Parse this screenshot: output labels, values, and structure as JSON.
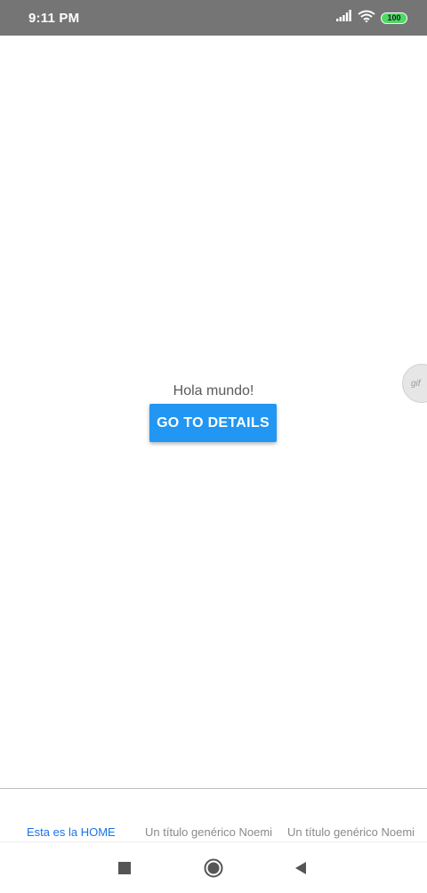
{
  "status_bar": {
    "time": "9:11 PM",
    "battery": "100"
  },
  "main": {
    "greeting": "Hola mundo!",
    "button_label": "GO TO DETAILS",
    "gif_badge": "gif"
  },
  "tabs": [
    {
      "label": "Esta es la HOME"
    },
    {
      "label": "Un título genérico Noemi"
    },
    {
      "label": "Un título genérico Noemi"
    }
  ],
  "icons": {
    "signal": "signal-icon",
    "wifi": "wifi-icon",
    "battery": "battery-icon",
    "recents": "recents-icon",
    "home": "home-icon",
    "back": "back-icon"
  },
  "colors": {
    "status_bar": "#757575",
    "accent": "#2196f3",
    "active_tab": "#1a73e8",
    "inactive_tab": "#8a8a8a",
    "battery": "#4cd964"
  }
}
